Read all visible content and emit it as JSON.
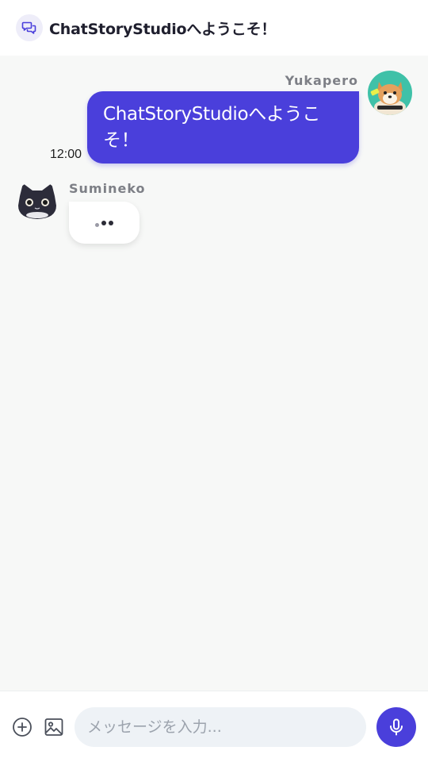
{
  "header": {
    "title": "ChatStoryStudioへようこそ！",
    "icon": "chat-bubbles-icon"
  },
  "messages": [
    {
      "sender": "Yukapero",
      "side": "right",
      "text": "ChatStoryStudioへようこ\nそ！",
      "time": "12:00",
      "avatar": "shiba-dog-avatar"
    },
    {
      "sender": "Sumineko",
      "side": "left",
      "typing": true,
      "avatar": "black-cat-avatar"
    }
  ],
  "composer": {
    "placeholder": "メッセージを入力...",
    "value": "",
    "buttons": [
      "plus-circle-icon",
      "image-icon",
      "microphone-icon"
    ]
  },
  "colors": {
    "accent": "#4a3fdb",
    "background": "#f7f8f7",
    "header_bg": "#ffffff",
    "input_bg": "#eef2f6",
    "name_text": "#7d7f86"
  }
}
